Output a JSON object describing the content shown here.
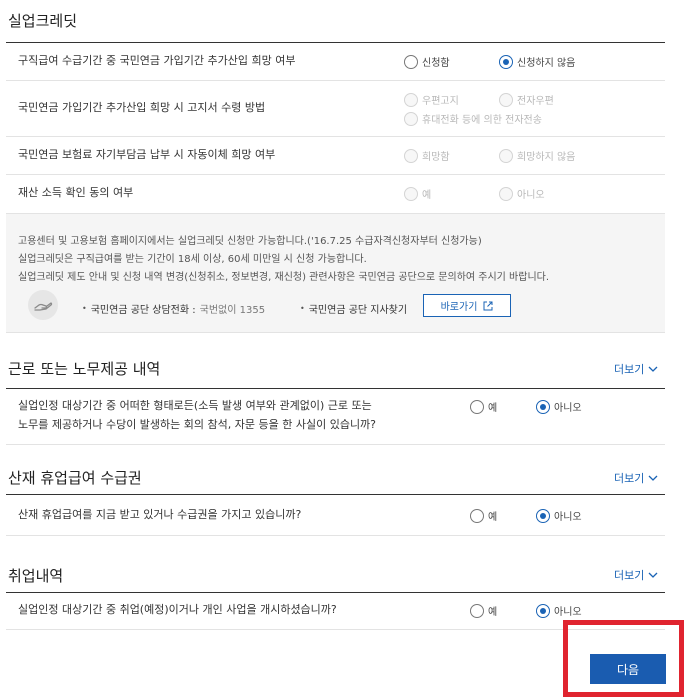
{
  "pension_credit": {
    "title": "실업크레딧",
    "questions": [
      {
        "label": "구직급여 수급기간 중 국민연금 가입기간 추가산입 희망 여부",
        "options": [
          "신청함",
          "신청하지 않음"
        ],
        "selected": "신청하지 않음"
      },
      {
        "label": "국민연금 가입기간 추가산입 희망 시 고지서 수령 방법",
        "options": [
          "우편고지",
          "전자우편",
          "휴대전화 등에 의한 전자전송"
        ]
      },
      {
        "label": "국민연금 보험료 자기부담금 납부 시 자동이체 희망 여부",
        "options": [
          "희망함",
          "희망하지 않음"
        ]
      },
      {
        "label": "재산 소득 확인 동의 여부",
        "options": [
          "예",
          "아니오"
        ]
      }
    ],
    "info_lines": [
      "고용센터 및 고용보험 홈페이지에서는 실업크레딧 신청만 가능합니다.('16.7.25 수급자격신청자부터 신청가능)",
      "실업크레딧은 구직급여를 받는 기간이 18세 이상, 60세 미만일 시 신청 가능합니다.",
      "실업크레딧 제도 안내 및 신청 내역 변경(신청취소, 정보변경, 재신청) 관련사항은 국민연금 공단으로 문의하여 주시기 바랍니다."
    ],
    "contact_phone_label": "국민연금 공단 상담전화 :",
    "contact_phone_value": "국번없이 1355",
    "contact_branch_label": "국민연금 공단 지사찾기",
    "shortcut_label": "바로가기"
  },
  "work_section": {
    "title": "근로 또는 노무제공 내역",
    "more_label": "더보기",
    "question_line1": "실업인정 대상기간 중 어떠한 형태로든(소득 발생 여부와 관계없이) 근로 또는",
    "question_line2": "노무를 제공하거나 수당이 발생하는 회의 참석, 자문 등을 한 사실이 있습니까?",
    "options": [
      "예",
      "아니오"
    ],
    "selected": "아니오"
  },
  "injury_section": {
    "title": "산재 휴업급여 수급권",
    "more_label": "더보기",
    "question": "산재 휴업급여를 지금 받고 있거나 수급권을 가지고 있습니까?",
    "options": [
      "예",
      "아니오"
    ],
    "selected": "아니오"
  },
  "employment_section": {
    "title": "취업내역",
    "more_label": "더보기",
    "question": "실업인정 대상기간 중 취업(예정)이거나 개인 사업을 개시하셨습니까?",
    "options": [
      "예",
      "아니오"
    ],
    "selected": "아니오"
  },
  "next_button_label": "다음",
  "colors": {
    "accent": "#1a5cb0",
    "highlight": "#e0242f"
  }
}
